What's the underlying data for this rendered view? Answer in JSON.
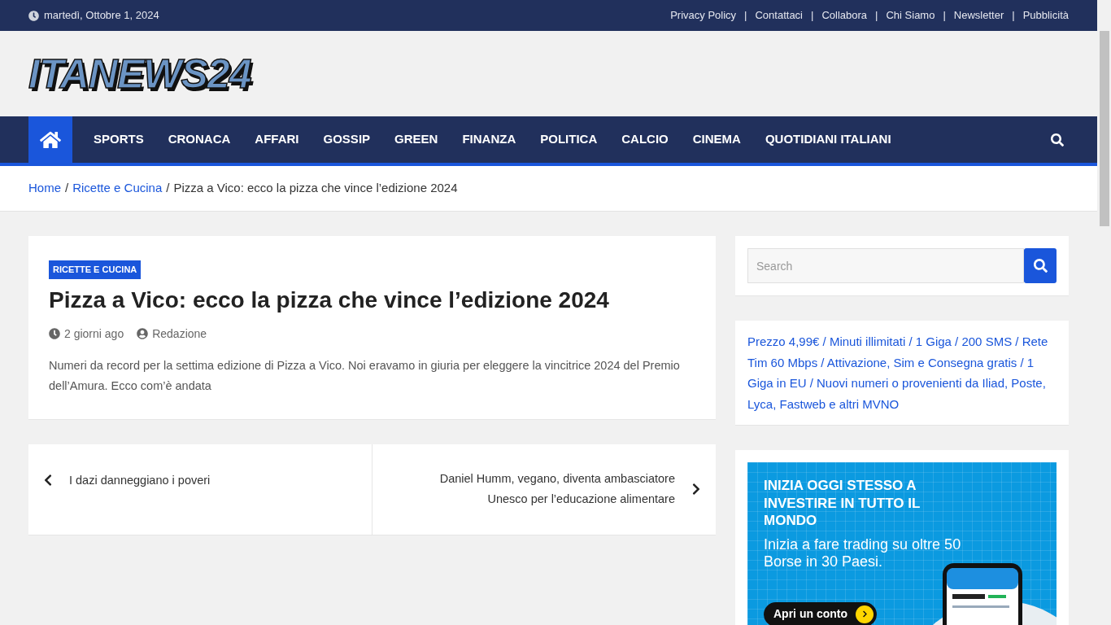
{
  "top_bar": {
    "date": "martedì, Ottobre 1, 2024",
    "links": [
      {
        "label": "Privacy Policy"
      },
      {
        "label": "Contattaci"
      },
      {
        "label": "Collabora"
      },
      {
        "label": "Chi Siamo"
      },
      {
        "label": "Newsletter"
      },
      {
        "label": "Pubblicità"
      }
    ],
    "separator": "|"
  },
  "logo": "ITANEWS24",
  "nav": {
    "home_selected": true,
    "items": [
      {
        "label": "SPORTS",
        "selected": false
      },
      {
        "label": "CRONACA",
        "selected": false
      },
      {
        "label": "AFFARI",
        "selected": false
      },
      {
        "label": "GOSSIP",
        "selected": false
      },
      {
        "label": "GREEN",
        "selected": false
      },
      {
        "label": "FINANZA",
        "selected": false
      },
      {
        "label": "POLITICA",
        "selected": false
      },
      {
        "label": "CALCIO",
        "selected": false
      },
      {
        "label": "CINEMA",
        "selected": false
      },
      {
        "label": "QUOTIDIANI ITALIANI",
        "selected": false
      }
    ]
  },
  "breadcrumb": {
    "items": [
      "Home",
      "Ricette e Cucina"
    ],
    "current": "Pizza a Vico: ecco la pizza che vince l’edizione 2024",
    "separator": "/"
  },
  "article": {
    "category": "RICETTE E CUCINA",
    "title": "Pizza a Vico: ecco la pizza che vince l’edizione 2024",
    "date": "2 giorni ago",
    "author": "Redazione",
    "excerpt": "Numeri da record per la settima edizione di Pizza a Vico. Noi eravamo in giuria per eleggere la vincitrice 2024 del Premio dell’Amura. Ecco com’è andata"
  },
  "post_nav": {
    "previous": "I dazi danneggiano i poveri",
    "next": "Daniel Humm, vegano, diventa ambasciatore Unesco per l’educazione alimentare"
  },
  "sidebar": {
    "search": {
      "placeholder": "Search"
    },
    "promo": "Prezzo 4,99€ / Minuti illimitati / 1 Giga / 200 SMS / Rete Tim 60 Mbps / Attivazione, Sim e Consegna gratis / 1 Giga in EU / Nuovi numeri o provenienti da Iliad, Poste, Lyca, Fastweb e altri MVNO",
    "ad": {
      "headline": "INIZIA OGGI STESSO A INVESTIRE IN TUTTO IL MONDO",
      "subline": "Inizia a fare trading su oltre 50 Borse in 30 Paesi.",
      "button": "Apri un conto"
    }
  }
}
